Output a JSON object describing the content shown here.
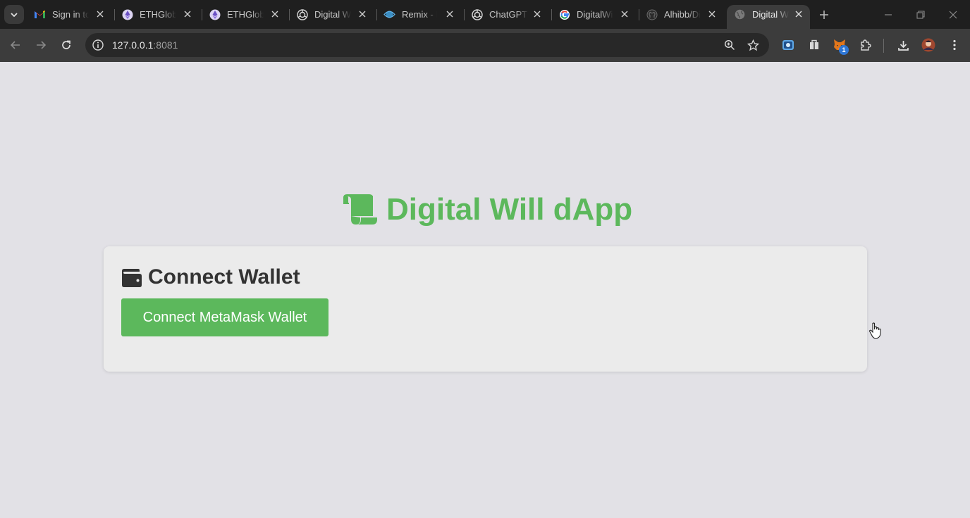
{
  "browser": {
    "tabs": [
      {
        "title": "Sign in to",
        "favicon": "gmail-icon"
      },
      {
        "title": "ETHGloba",
        "favicon": "ethglobal-icon"
      },
      {
        "title": "ETHGloba",
        "favicon": "ethglobal-icon"
      },
      {
        "title": "Digital Wi",
        "favicon": "openai-icon"
      },
      {
        "title": "Remix - E",
        "favicon": "remix-icon"
      },
      {
        "title": "ChatGPT",
        "favicon": "openai-icon"
      },
      {
        "title": "DigitalWi",
        "favicon": "google-icon"
      },
      {
        "title": "Alhibb/Di",
        "favicon": "github-icon"
      },
      {
        "title": "Digital W",
        "favicon": "globe-icon",
        "active": true
      }
    ],
    "address": {
      "host": "127.0.0.1",
      "port": ":8081"
    },
    "extension_badge": "1"
  },
  "page": {
    "heading": "Digital Will dApp",
    "card": {
      "title": "Connect Wallet",
      "button_label": "Connect MetaMask Wallet"
    }
  },
  "colors": {
    "accent": "#5cb85c",
    "page_bg": "#e2e1e6",
    "card_bg": "#ebebeb",
    "text_dark": "#333333"
  }
}
